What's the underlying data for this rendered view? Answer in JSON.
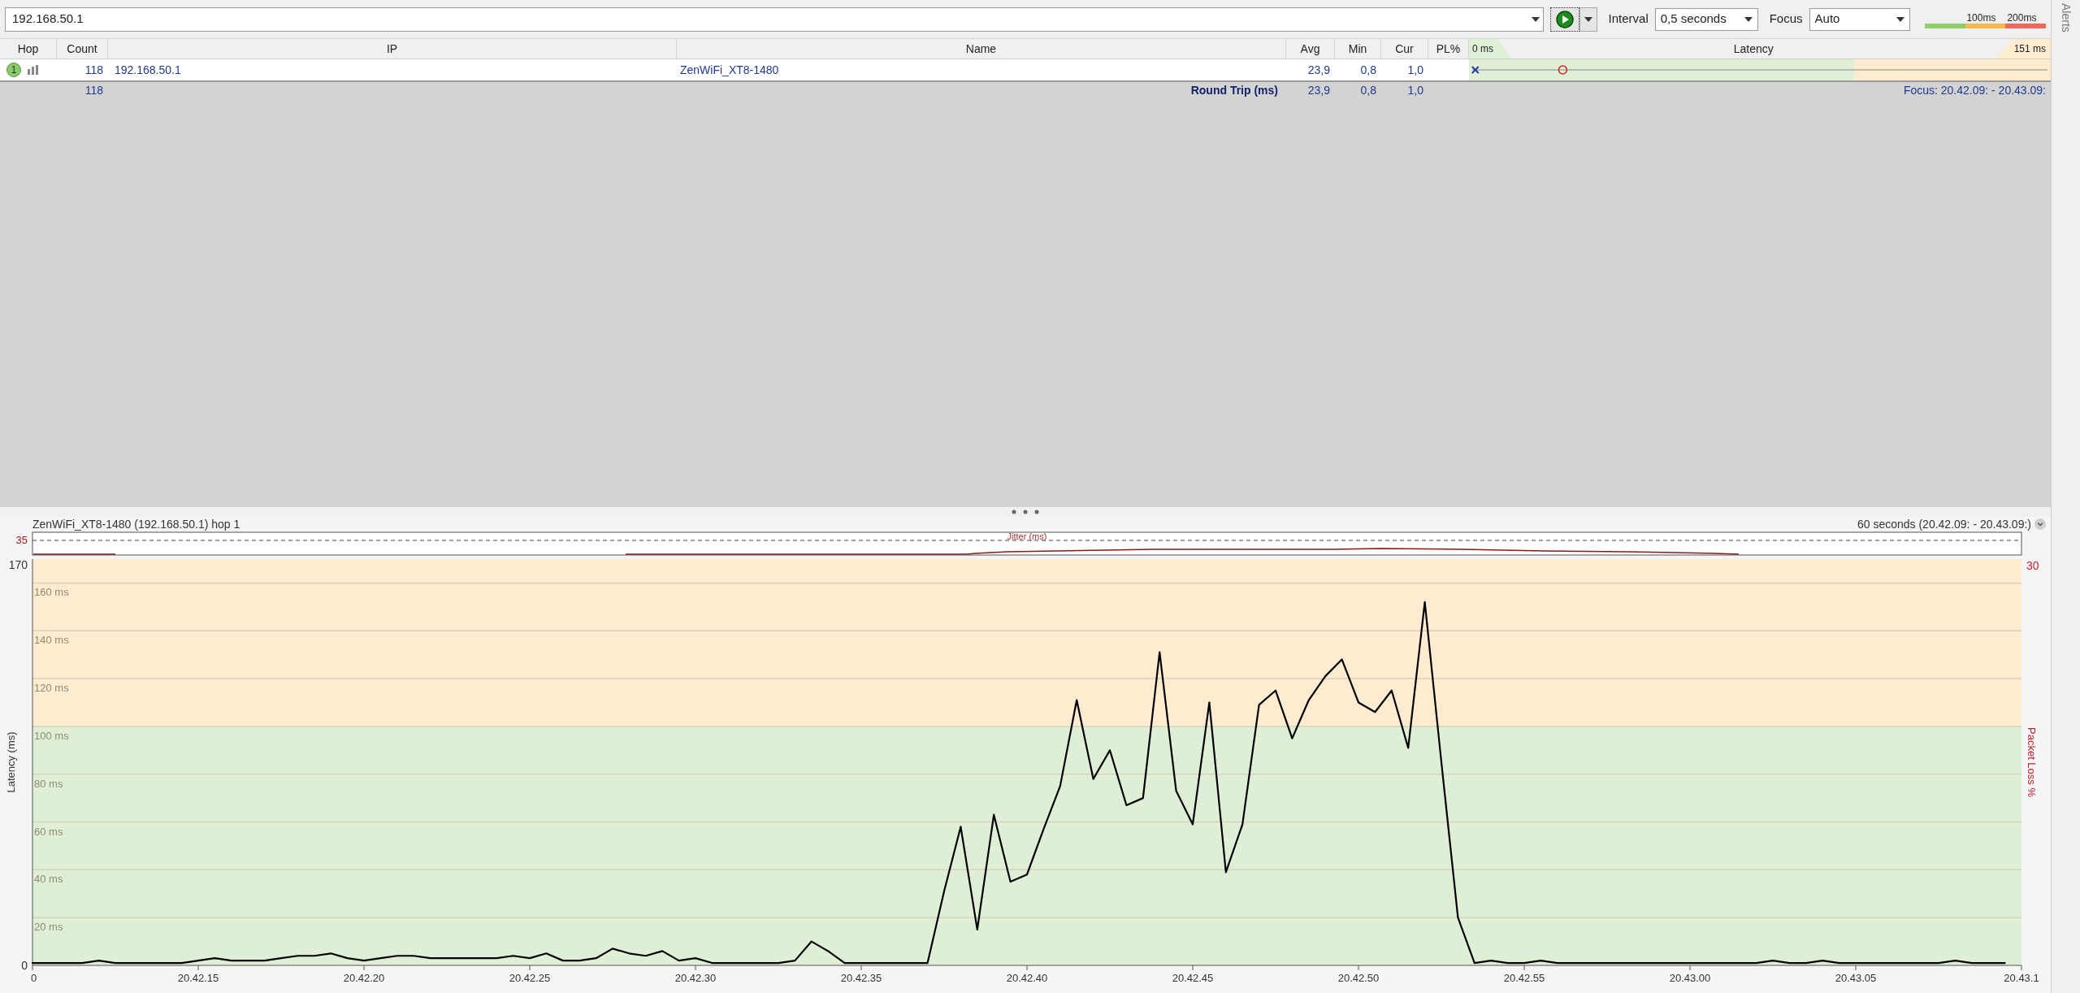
{
  "toolbar": {
    "target": "192.168.50.1",
    "interval_label": "Interval",
    "interval": "0,5 seconds",
    "focus_label": "Focus",
    "focus": "Auto",
    "legend": [
      "100ms",
      "200ms"
    ]
  },
  "side_panel": {
    "title": "Alerts"
  },
  "table": {
    "columns": [
      "Hop",
      "Count",
      "IP",
      "Name",
      "Avg",
      "Min",
      "Cur",
      "PL%"
    ],
    "latency_column": {
      "title": "Latency",
      "min_label": "0 ms",
      "max_label": "151 ms"
    },
    "rows": [
      {
        "hop": "1",
        "count": "118",
        "ip": "192.168.50.1",
        "name": "ZenWiFi_XT8-1480",
        "avg": "23,9",
        "min": "0,8",
        "cur": "1,0"
      }
    ],
    "summary": {
      "count": "118",
      "label": "Round Trip (ms)",
      "avg": "23,9",
      "min": "0,8",
      "cur": "1,0",
      "focus": "Focus: 20.42.09: - 20.43.09:"
    }
  },
  "graph": {
    "title": "ZenWiFi_XT8-1480 (192.168.50.1) hop 1",
    "range": "60 seconds (20.42.09: - 20.43.09:)",
    "jitter": {
      "title": "Jitter (ms)",
      "max": "35"
    },
    "loss_axis": {
      "label": "Packet Loss %",
      "max": "30"
    },
    "latency_axis": {
      "min": "0",
      "max": "170"
    },
    "chart_data": {
      "type": "line",
      "ylabel": "Latency (ms)",
      "ylim": [
        0,
        170
      ],
      "grid": true,
      "bands": [
        {
          "axis": "y",
          "from": 0,
          "to": 100,
          "color": "#dfefd6"
        },
        {
          "axis": "y",
          "from": 100,
          "to": 170,
          "color": "#feebd0"
        }
      ],
      "categories": [
        "0",
        null,
        null,
        null,
        null,
        null,
        null,
        null,
        null,
        null,
        "20.42.15",
        null,
        null,
        null,
        null,
        null,
        null,
        null,
        null,
        null,
        "20.42.20",
        null,
        null,
        null,
        null,
        null,
        null,
        null,
        null,
        null,
        "20.42.25",
        null,
        null,
        null,
        null,
        null,
        null,
        null,
        null,
        null,
        "20.42.30",
        null,
        null,
        null,
        null,
        null,
        null,
        null,
        null,
        null,
        "20.42.35",
        null,
        null,
        null,
        null,
        null,
        null,
        null,
        null,
        null,
        "20.42.40",
        null,
        null,
        null,
        null,
        null,
        null,
        null,
        null,
        null,
        "20.42.45",
        null,
        null,
        null,
        null,
        null,
        null,
        null,
        null,
        null,
        "20.42.50",
        null,
        null,
        null,
        null,
        null,
        null,
        null,
        null,
        null,
        "20.42.55",
        null,
        null,
        null,
        null,
        null,
        null,
        null,
        null,
        null,
        "20.43.00",
        null,
        null,
        null,
        null,
        null,
        null,
        null,
        null,
        null,
        "20.43.05",
        null,
        null,
        null,
        null,
        null,
        null,
        null,
        null,
        null,
        "20.43.1"
      ],
      "yticks": [
        {
          "value": 20,
          "label": "20 ms"
        },
        {
          "value": 40,
          "label": "40 ms"
        },
        {
          "value": 60,
          "label": "60 ms"
        },
        {
          "value": 80,
          "label": "80 ms"
        },
        {
          "value": 100,
          "label": "100 ms"
        },
        {
          "value": 120,
          "label": "120 ms"
        },
        {
          "value": 140,
          "label": "140 ms"
        },
        {
          "value": 160,
          "label": "160 ms"
        }
      ],
      "series": [
        {
          "color": "#000000",
          "values": [
            1,
            1,
            1,
            1,
            2,
            1,
            1,
            1,
            1,
            1,
            2,
            3,
            2,
            2,
            2,
            3,
            4,
            4,
            5,
            3,
            2,
            3,
            4,
            4,
            3,
            3,
            3,
            3,
            3,
            4,
            3,
            5,
            2,
            2,
            3,
            7,
            5,
            4,
            6,
            2,
            3,
            1,
            1,
            1,
            1,
            1,
            2,
            10,
            6,
            1,
            1,
            1,
            1,
            1,
            1,
            31,
            58,
            15,
            63,
            35,
            38,
            57,
            75,
            111,
            78,
            90,
            67,
            70,
            131,
            73,
            59,
            110,
            39,
            59,
            109,
            115,
            95,
            111,
            121,
            128,
            110,
            106,
            115,
            91,
            152,
            85,
            20,
            1,
            2,
            1,
            1,
            2,
            1,
            1,
            1,
            1,
            1,
            1,
            1,
            1,
            1,
            1,
            1,
            1,
            1,
            2,
            1,
            1,
            2,
            1,
            1,
            1,
            1,
            1,
            1,
            1,
            2,
            1,
            1,
            1,
            null
          ]
        }
      ]
    }
  }
}
